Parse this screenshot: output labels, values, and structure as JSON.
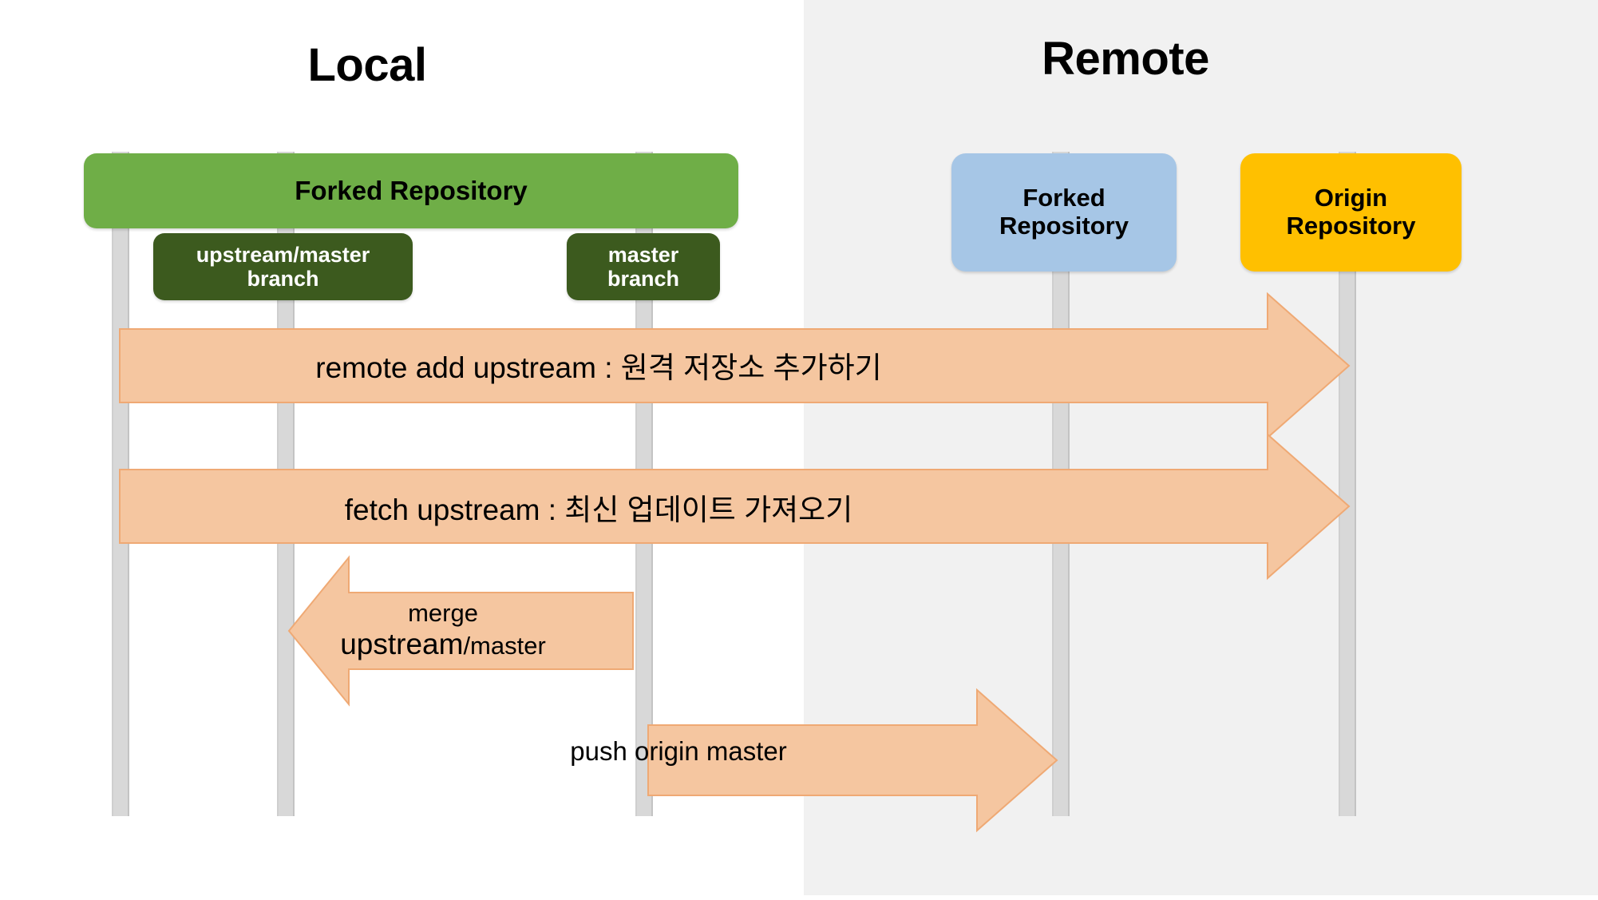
{
  "diagram": {
    "title": "Git fork workflow: Local and Remote repositories",
    "zones": {
      "local": {
        "label": "Local",
        "background": "#FFFFFF"
      },
      "remote": {
        "label": "Remote",
        "background": "#F1F1F1"
      }
    },
    "colors": {
      "local_repo_green": "#6FAE47",
      "branch_dark_green": "#3C5A1E",
      "remote_forked_blue": "#A6C6E6",
      "origin_gold": "#FFC000",
      "arrow_fill": "#F5C6A0",
      "arrow_stroke": "#EFA974",
      "pole_gray": "#D8D8D8",
      "remote_zone_gray": "#F1F1F1"
    },
    "signs": [
      {
        "id": "forked-repository-local",
        "label": "Forked Repository",
        "zone": "local",
        "color": "#6FAE47"
      },
      {
        "id": "upstream-master-branch",
        "label_line1": "upstream/master",
        "label_line2": "branch",
        "zone": "local",
        "color": "#3C5A1E"
      },
      {
        "id": "master-branch",
        "label_line1": "master",
        "label_line2": "branch",
        "zone": "local",
        "color": "#3C5A1E"
      },
      {
        "id": "forked-repository-remote",
        "label_line1": "Forked",
        "label_line2": "Repository",
        "zone": "remote",
        "color": "#A6C6E6"
      },
      {
        "id": "origin-repository",
        "label_line1": "Origin",
        "label_line2": "Repository",
        "zone": "remote",
        "color": "#FFC000"
      }
    ],
    "arrows": [
      {
        "id": "remote-add-upstream",
        "label": "remote add upstream : 원격 저장소 추가하기",
        "direction": "right",
        "from": "local-forked-repository",
        "to": "origin-repository"
      },
      {
        "id": "fetch-upstream",
        "label": "fetch upstream : 최신 업데이트 가져오기",
        "direction": "right",
        "from": "local-forked-repository",
        "to": "origin-repository"
      },
      {
        "id": "merge-upstream-master",
        "label_line1": "merge",
        "label_line2_big": "upstream",
        "label_line2_small": "/master",
        "direction": "left",
        "from": "master-branch",
        "to": "upstream-master-branch"
      },
      {
        "id": "push-origin-master",
        "label": "push origin master",
        "direction": "right",
        "from": "master-branch",
        "to": "forked-repository-remote"
      }
    ]
  }
}
